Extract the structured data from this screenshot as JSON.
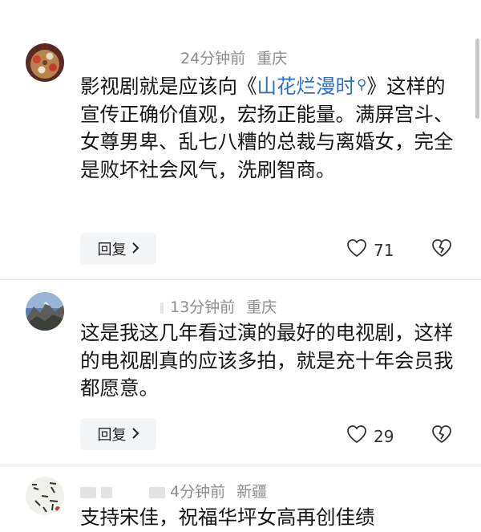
{
  "comments": [
    {
      "time": "24分钟前",
      "location": "重庆",
      "text_before": "影视剧就是应该向《",
      "link_text": "山花烂漫时",
      "text_after": "》这样的宣传正确价值观，宏扬正能量。满屏宫斗、女尊男卑、乱七八糟的总裁与离婚女，完全是败坏社会风气，洗刷智商。",
      "reply_label": "回复",
      "likes": "71"
    },
    {
      "time": "13分钟前",
      "location": "重庆",
      "text": "这是我这几年看过演的最好的电视剧，这样的电视剧真的应该多拍，就是充十年会员我都愿意。",
      "reply_label": "回复",
      "likes": "29"
    },
    {
      "time": "4分钟前",
      "location": "新疆",
      "text": "支持宋佳，祝福华坪女高再创佳绩"
    }
  ],
  "colors": {
    "link": "#2f6fc9",
    "meta": "#8d8d8d",
    "reply_bg": "#f4f5f7"
  }
}
